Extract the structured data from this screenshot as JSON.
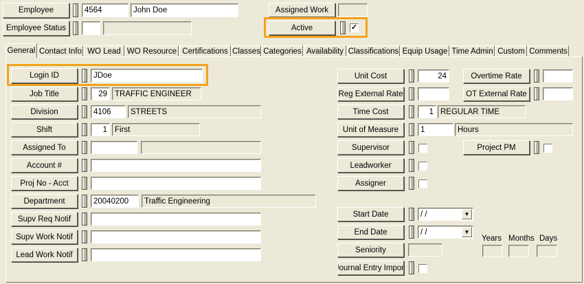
{
  "header": {
    "employee_label": "Employee",
    "employee_id": "4564",
    "employee_name": "John Doe",
    "status_label": "Employee Status",
    "status_value": "",
    "status_desc": "",
    "assigned_work_label": "Assigned Work",
    "active_label": "Active",
    "active_checked": "✓"
  },
  "tabs": [
    "General",
    "Contact Info",
    "WO Lead",
    "WO Resource",
    "Certifications",
    "Classes",
    "Categories",
    "Availability",
    "Classifications",
    "Equip Usage",
    "Time Admin",
    "Custom",
    "Comments"
  ],
  "left_fields": {
    "login_id": {
      "label": "Login ID",
      "value": "JDoe"
    },
    "job_title": {
      "label": "Job Title",
      "code": "29",
      "desc": "TRAFFIC ENGINEER"
    },
    "division": {
      "label": "Division",
      "code": "4106",
      "desc": "STREETS"
    },
    "shift": {
      "label": "Shift",
      "code": "1",
      "desc": "First"
    },
    "assigned_to": {
      "label": "Assigned To",
      "code": "",
      "desc": ""
    },
    "account": {
      "label": "Account #",
      "value": ""
    },
    "proj_no": {
      "label": "Proj No - Acct",
      "value": ""
    },
    "department": {
      "label": "Department",
      "code": "20040200",
      "desc": "Traffic Engineering"
    },
    "supv_req_notif": {
      "label": "Supv Req Notif",
      "value": ""
    },
    "supv_work_notif": {
      "label": "Supv Work Notif",
      "value": ""
    },
    "lead_work_notif": {
      "label": "Lead Work Notif",
      "value": ""
    }
  },
  "right_fields": {
    "unit_cost": {
      "label": "Unit Cost",
      "value": "24"
    },
    "overtime_rate": {
      "label": "Overtime Rate",
      "value": ""
    },
    "reg_external_rate": {
      "label": "Reg External Rate",
      "value": ""
    },
    "ot_external_rate": {
      "label": "OT External Rate",
      "value": ""
    },
    "time_cost": {
      "label": "Time Cost",
      "code": "1",
      "desc": "REGULAR TIME"
    },
    "unit_of_measure": {
      "label": "Unit of Measure",
      "code": "1",
      "desc": "Hours"
    },
    "supervisor": {
      "label": "Supervisor"
    },
    "project_pm": {
      "label": "Project PM"
    },
    "leadworker": {
      "label": "Leadworker"
    },
    "assigner": {
      "label": "Assigner"
    },
    "start_date": {
      "label": "Start Date",
      "value": " /  /"
    },
    "end_date": {
      "label": "End Date",
      "value": " /  /"
    },
    "seniority": {
      "label": "Seniority",
      "value": ""
    },
    "journal_entry_import": {
      "label": "Journal Entry Import"
    },
    "years_label": "Years",
    "months_label": "Months",
    "days_label": "Days"
  },
  "colors": {
    "highlight": "#f2a31b",
    "background": "#ece9d8"
  }
}
